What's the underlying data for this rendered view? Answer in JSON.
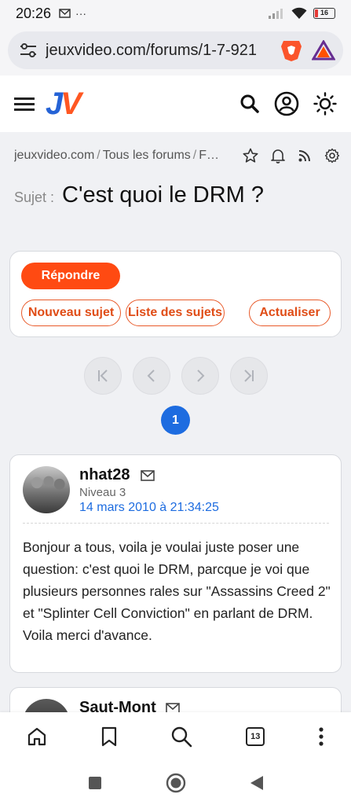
{
  "status": {
    "time": "20:26",
    "battery": "16"
  },
  "browser": {
    "url": "jeuxvideo.com/forums/1-7-921",
    "tab_count": "13"
  },
  "site": {
    "logo_j": "J",
    "logo_v": "V",
    "accent": "#ff4a12",
    "link_color": "#1d6ce0"
  },
  "breadcrumb": {
    "items": [
      "jeuxvideo.com",
      "Tous les forums",
      "F…"
    ]
  },
  "topic": {
    "label": "Sujet :",
    "title": "C'est quoi le DRM ?"
  },
  "actions": {
    "reply": "Répondre",
    "new_topic": "Nouveau sujet",
    "topic_list": "Liste des sujets",
    "refresh": "Actualiser"
  },
  "pagination": {
    "current_page": "1"
  },
  "posts": [
    {
      "author": "nhat28",
      "level": "Niveau 3",
      "date": "14 mars 2010 à 21:34:25",
      "body": "Bonjour a tous, voila je voulai juste poser une question: c'est quoi le DRM, parcque je voi que plusieurs personnes rales sur \"Assassins Creed 2\" et \"Splinter Cell Conviction\" en parlant de DRM. Voila merci d'avance."
    },
    {
      "author": "Saut-Mont"
    }
  ]
}
